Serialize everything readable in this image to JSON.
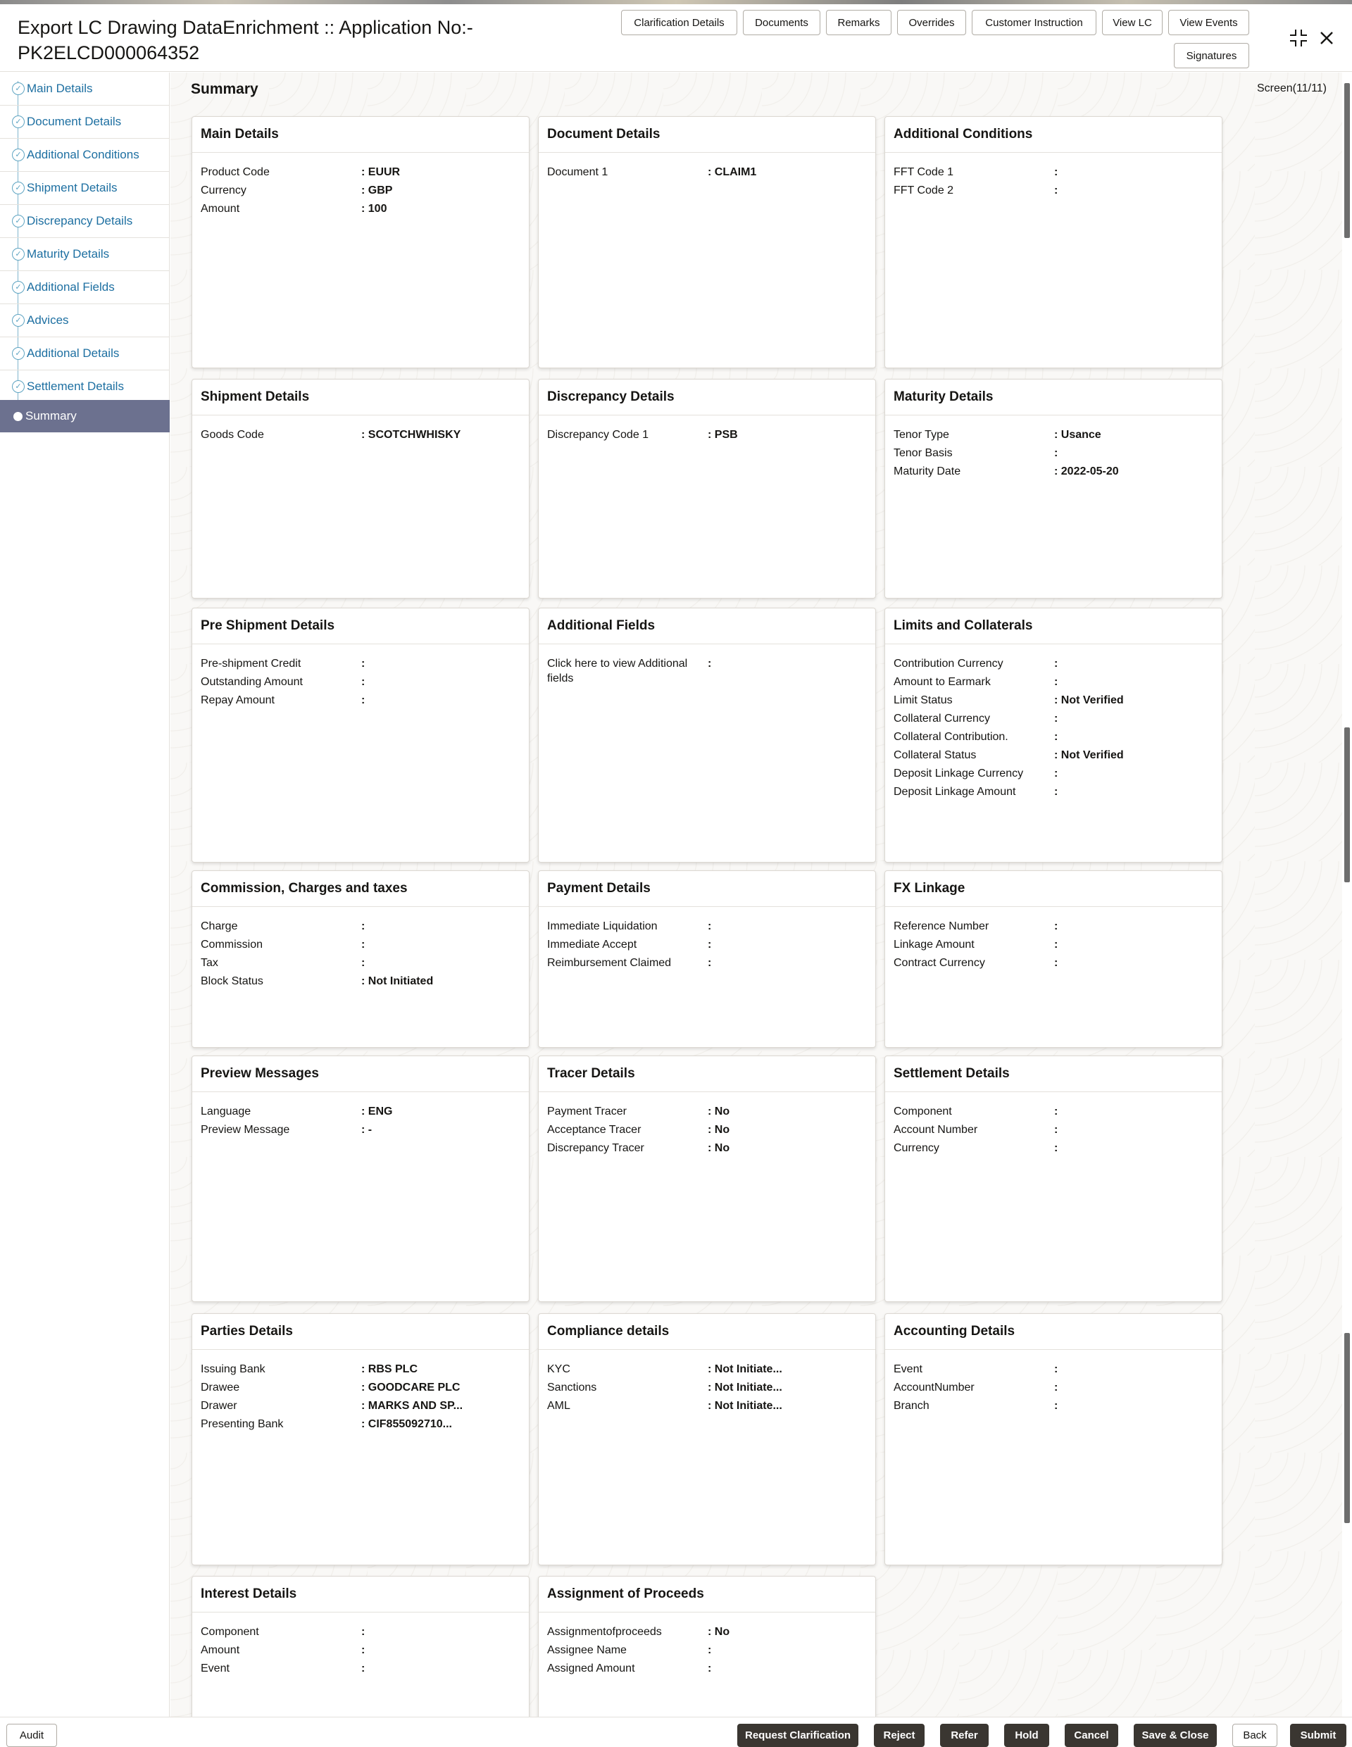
{
  "header": {
    "title": "Export LC Drawing DataEnrichment :: Application No:- PK2ELCD000064352",
    "buttons": [
      "Clarification Details",
      "Documents",
      "Remarks",
      "Overrides",
      "Customer Instruction",
      "View LC",
      "View Events",
      "Signatures"
    ],
    "icons": {
      "expand": "compress-icon",
      "close": "close-icon"
    }
  },
  "sidebar": {
    "items": [
      {
        "label": "Main Details"
      },
      {
        "label": "Document Details"
      },
      {
        "label": "Additional Conditions"
      },
      {
        "label": "Shipment Details"
      },
      {
        "label": "Discrepancy Details"
      },
      {
        "label": "Maturity Details"
      },
      {
        "label": "Additional Fields"
      },
      {
        "label": "Advices"
      },
      {
        "label": "Additional Details"
      },
      {
        "label": "Settlement Details"
      },
      {
        "label": "Summary",
        "active": true
      }
    ]
  },
  "main": {
    "title": "Summary",
    "screen_count": "Screen(11/11)",
    "cards": [
      {
        "title": "Main Details",
        "rows": [
          {
            "label": "Product Code",
            "value": ": EUUR"
          },
          {
            "label": "Currency",
            "value": ": GBP"
          },
          {
            "label": "Amount",
            "value": ": 100"
          }
        ]
      },
      {
        "title": "Document Details",
        "rows": [
          {
            "label": "Document 1",
            "value": ": CLAIM1"
          }
        ]
      },
      {
        "title": "Additional Conditions",
        "rows": [
          {
            "label": "FFT Code 1",
            "value": ":"
          },
          {
            "label": "FFT Code 2",
            "value": ":"
          }
        ]
      },
      {
        "title": "Shipment Details",
        "rows": [
          {
            "label": "Goods Code",
            "value": ": SCOTCHWHISKY"
          }
        ]
      },
      {
        "title": "Discrepancy Details",
        "rows": [
          {
            "label": "Discrepancy Code 1",
            "value": ": PSB"
          }
        ]
      },
      {
        "title": "Maturity Details",
        "rows": [
          {
            "label": "Tenor Type",
            "value": ": Usance"
          },
          {
            "label": "Tenor Basis",
            "value": ":"
          },
          {
            "label": "Maturity Date",
            "value": ": 2022-05-20"
          }
        ]
      },
      {
        "title": "Pre Shipment Details",
        "rows": [
          {
            "label": "Pre-shipment Credit",
            "value": ":"
          },
          {
            "label": "Outstanding Amount",
            "value": ":"
          },
          {
            "label": "Repay Amount",
            "value": ":"
          }
        ]
      },
      {
        "title": "Additional Fields",
        "rows": [
          {
            "label": "Click here to view Additional fields",
            "value": ":"
          }
        ]
      },
      {
        "title": "Limits and Collaterals",
        "rows": [
          {
            "label": "Contribution Currency",
            "value": ":"
          },
          {
            "label": "Amount to Earmark",
            "value": ":"
          },
          {
            "label": "Limit Status",
            "value": ": Not Verified"
          },
          {
            "label": "Collateral Currency",
            "value": ":"
          },
          {
            "label": "Collateral Contribution.",
            "value": ":"
          },
          {
            "label": "Collateral Status",
            "value": ": Not Verified"
          },
          {
            "label": "Deposit Linkage Currency",
            "value": ":"
          },
          {
            "label": "Deposit Linkage Amount",
            "value": ":"
          }
        ]
      },
      {
        "title": "Commission, Charges and taxes",
        "rows": [
          {
            "label": "Charge",
            "value": ":"
          },
          {
            "label": "Commission",
            "value": ":"
          },
          {
            "label": "Tax",
            "value": ":"
          },
          {
            "label": "Block Status",
            "value": ": Not Initiated"
          }
        ]
      },
      {
        "title": "Payment Details",
        "rows": [
          {
            "label": "Immediate Liquidation",
            "value": ":"
          },
          {
            "label": "Immediate Accept",
            "value": ":"
          },
          {
            "label": "Reimbursement Claimed",
            "value": ":"
          }
        ]
      },
      {
        "title": "FX Linkage",
        "rows": [
          {
            "label": "Reference Number",
            "value": ":"
          },
          {
            "label": "Linkage Amount",
            "value": ":"
          },
          {
            "label": "Contract Currency",
            "value": ":"
          }
        ]
      },
      {
        "title": "Preview Messages",
        "rows": [
          {
            "label": "Language",
            "value": ": ENG"
          },
          {
            "label": "Preview Message",
            "value": ": -"
          }
        ]
      },
      {
        "title": "Tracer Details",
        "rows": [
          {
            "label": "Payment Tracer",
            "value": ": No"
          },
          {
            "label": "Acceptance Tracer",
            "value": ": No"
          },
          {
            "label": "Discrepancy Tracer",
            "value": ": No"
          }
        ]
      },
      {
        "title": "Settlement Details",
        "rows": [
          {
            "label": "Component",
            "value": ":"
          },
          {
            "label": "Account Number",
            "value": ":"
          },
          {
            "label": "Currency",
            "value": ":"
          }
        ]
      },
      {
        "title": "Parties Details",
        "rows": [
          {
            "label": "Issuing Bank",
            "value": ": RBS PLC"
          },
          {
            "label": "Drawee",
            "value": ": GOODCARE PLC"
          },
          {
            "label": "Drawer",
            "value": ": MARKS AND SP..."
          },
          {
            "label": "Presenting Bank",
            "value": ": CIF855092710..."
          }
        ]
      },
      {
        "title": "Compliance details",
        "rows": [
          {
            "label": "KYC",
            "value": ": Not Initiate..."
          },
          {
            "label": "Sanctions",
            "value": ": Not Initiate..."
          },
          {
            "label": "AML",
            "value": ": Not Initiate..."
          }
        ]
      },
      {
        "title": "Accounting Details",
        "rows": [
          {
            "label": "Event",
            "value": ":"
          },
          {
            "label": "AccountNumber",
            "value": ":"
          },
          {
            "label": "Branch",
            "value": ":"
          }
        ]
      },
      {
        "title": "Interest Details",
        "rows": [
          {
            "label": "Component",
            "value": ":"
          },
          {
            "label": "Amount",
            "value": ":"
          },
          {
            "label": "Event",
            "value": ":"
          }
        ]
      },
      {
        "title": "Assignment of Proceeds",
        "rows": [
          {
            "label": "Assignmentofproceeds",
            "value": ": No"
          },
          {
            "label": "Assignee Name",
            "value": ":"
          },
          {
            "label": "Assigned Amount",
            "value": ":"
          }
        ]
      }
    ]
  },
  "footer": {
    "left_button": "Audit",
    "buttons": [
      "Request Clarification",
      "Reject",
      "Refer",
      "Hold",
      "Cancel",
      "Save & Close",
      "Back",
      "Submit"
    ]
  }
}
